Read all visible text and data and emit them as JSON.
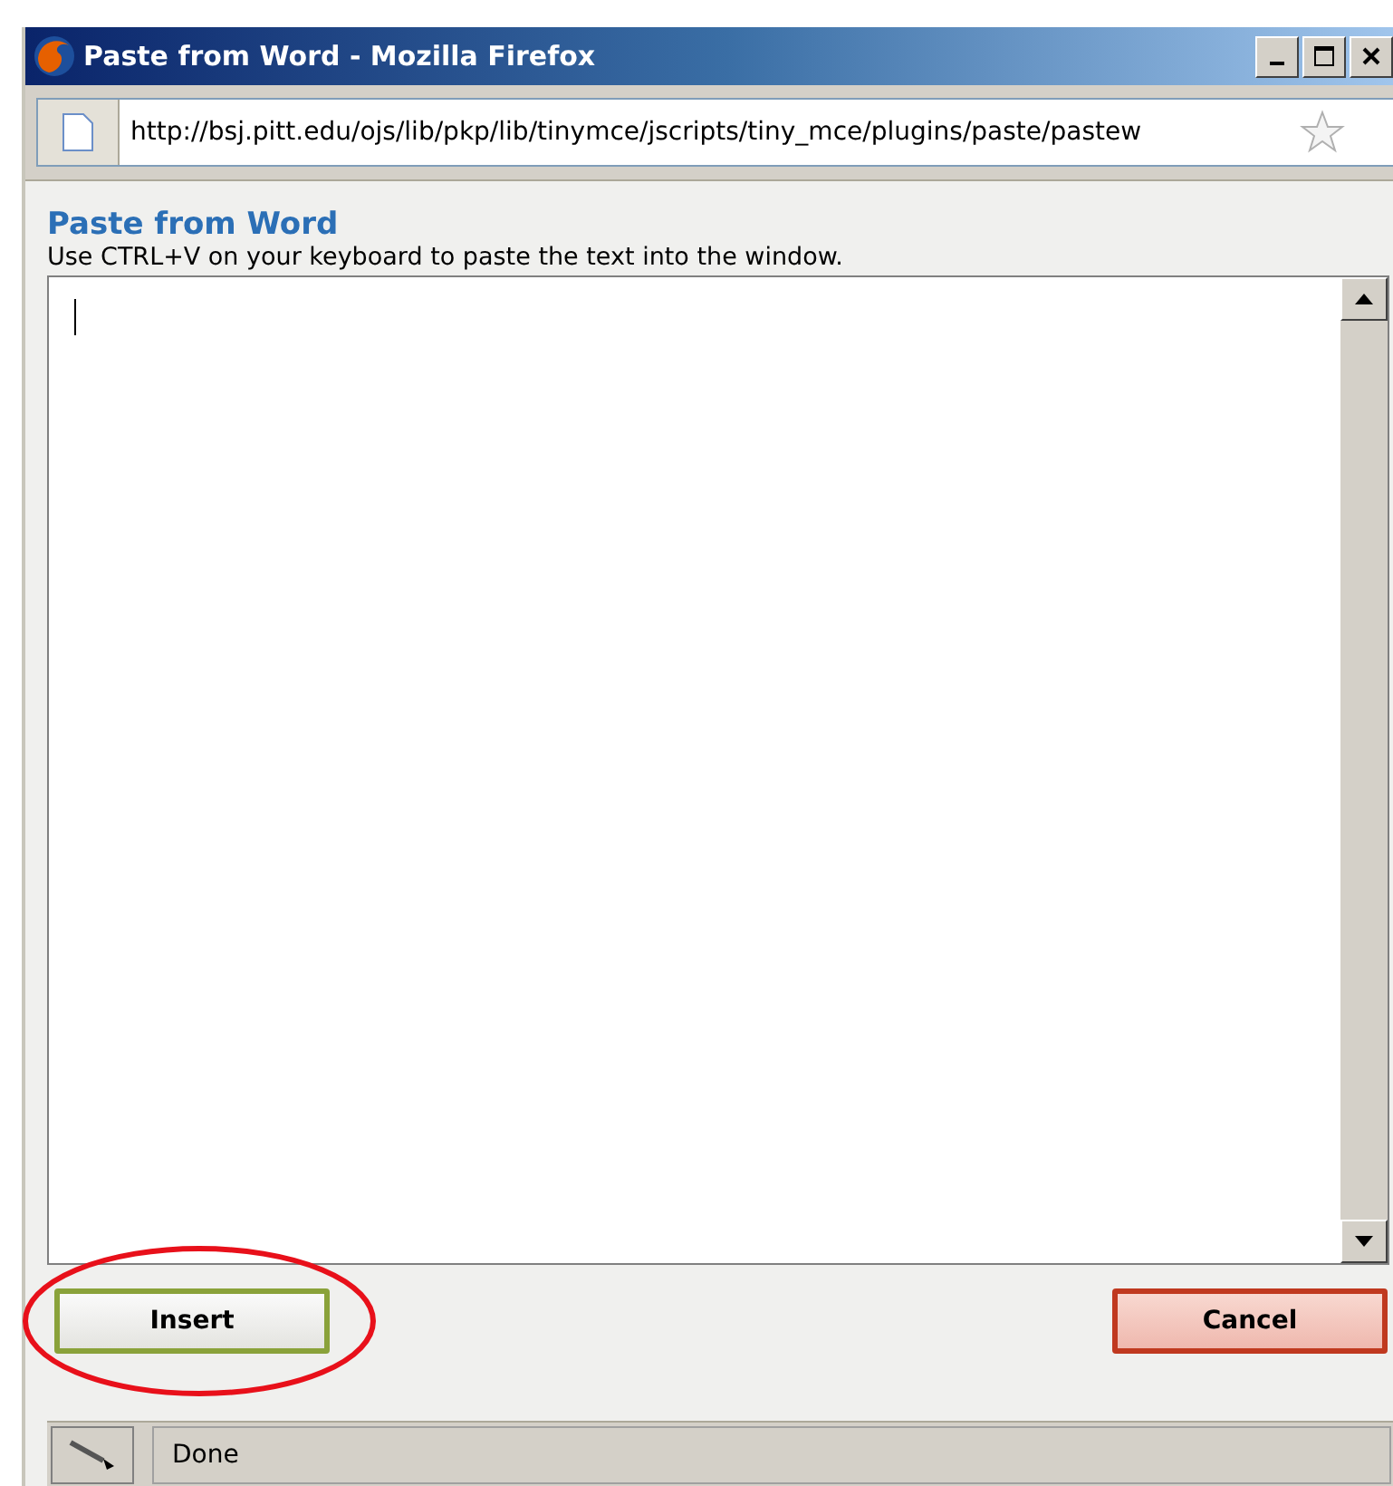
{
  "window": {
    "title": "Paste from Word - Mozilla Firefox"
  },
  "address_bar": {
    "url": "http://bsj.pitt.edu/ojs/lib/pkp/lib/tinymce/jscripts/tiny_mce/plugins/paste/pastew"
  },
  "dialog": {
    "heading": "Paste from Word",
    "instruction": "Use CTRL+V on your keyboard to paste the text into the window."
  },
  "buttons": [
    {
      "label": "Insert",
      "kind": "insert",
      "circled": true
    },
    {
      "label": "Cancel",
      "kind": "cancel",
      "circled": false
    }
  ],
  "status_bar": {
    "text": "Done"
  }
}
